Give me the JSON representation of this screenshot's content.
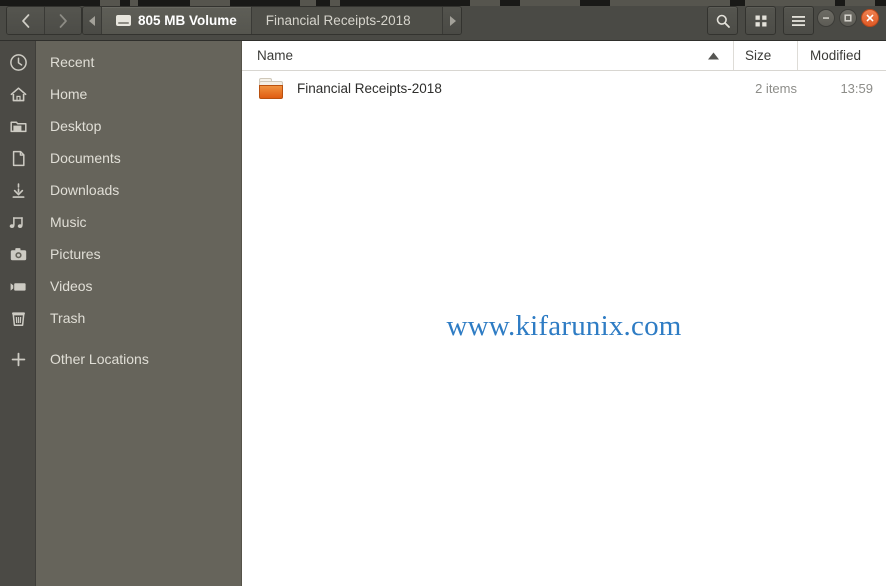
{
  "window": {
    "controls": {
      "minimize_label": "−",
      "maximize_label": "□",
      "close_label": "×",
      "close_color": "#e05a25"
    }
  },
  "header": {
    "nav": {
      "back_label": "‹",
      "forward_label": "›"
    },
    "pathbar": {
      "scroll_left_label": "◂",
      "scroll_right_label": "▸",
      "crumbs": [
        {
          "label": "805 MB Volume",
          "icon": "drive-icon",
          "active": true
        },
        {
          "label": "Financial Receipts-2018",
          "icon": "",
          "active": false
        }
      ]
    },
    "buttons": [
      {
        "name": "search-button",
        "icon": "search-icon"
      },
      {
        "name": "view-grid-button",
        "icon": "grid-view-icon"
      },
      {
        "name": "main-menu-button",
        "icon": "hamburger-menu-icon"
      }
    ]
  },
  "sidebar": {
    "items": [
      {
        "label": "Recent",
        "icon": "clock-icon"
      },
      {
        "label": "Home",
        "icon": "home-icon"
      },
      {
        "label": "Desktop",
        "icon": "folder-icon"
      },
      {
        "label": "Documents",
        "icon": "document-icon"
      },
      {
        "label": "Downloads",
        "icon": "download-arrow-icon"
      },
      {
        "label": "Music",
        "icon": "music-note-icon"
      },
      {
        "label": "Pictures",
        "icon": "camera-icon"
      },
      {
        "label": "Videos",
        "icon": "video-camera-icon"
      },
      {
        "label": "Trash",
        "icon": "trash-icon"
      },
      {
        "label": "Other Locations",
        "icon": "plus-icon"
      }
    ]
  },
  "file_list": {
    "columns": [
      {
        "label": "Name",
        "sorted": true,
        "sort_direction": "ascending"
      },
      {
        "label": "Size",
        "sorted": false,
        "sort_direction": ""
      },
      {
        "label": "Modified",
        "sorted": false,
        "sort_direction": ""
      }
    ],
    "rows": [
      {
        "name": "Financial Receipts-2018",
        "icon": "folder-icon",
        "size": "2 items",
        "modified": "13:59"
      }
    ]
  },
  "watermark": {
    "text": "www.kifarunix.com",
    "color": "#2e7cc4"
  }
}
